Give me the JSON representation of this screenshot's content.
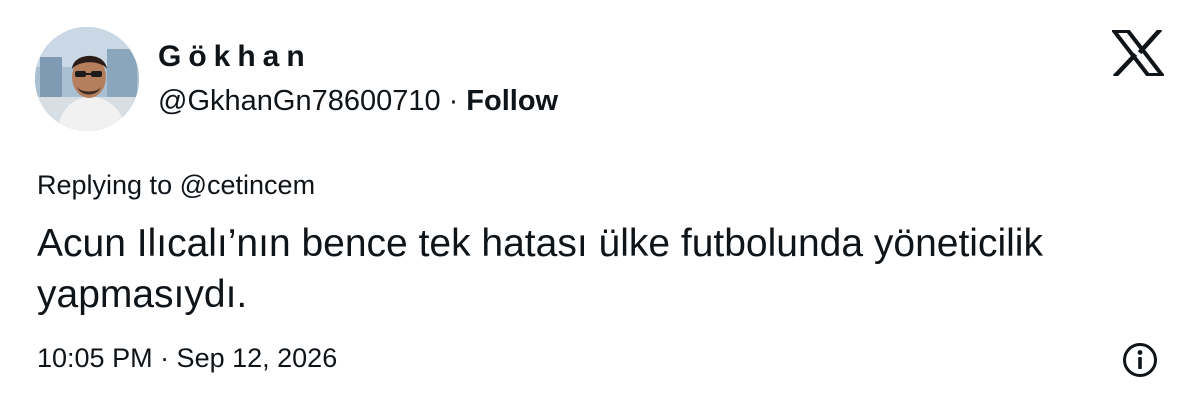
{
  "author": {
    "display_name": "Gökhan",
    "handle": "@GkhanGn78600710",
    "separator": "·",
    "follow_label": "Follow"
  },
  "platform_icon": "x-logo-icon",
  "reply": {
    "prefix": "Replying to",
    "mention": "@cetincem"
  },
  "tweet": {
    "text": "Acun Ilıcalı’nın bence tek hatası ülke futbolunda yöneticilik yapmasıydı."
  },
  "meta": {
    "timestamp": "10:05 PM · Sep 12, 2026"
  },
  "info_icon": "info-circle-icon",
  "colors": {
    "text": "#0f1419",
    "background": "#ffffff"
  }
}
